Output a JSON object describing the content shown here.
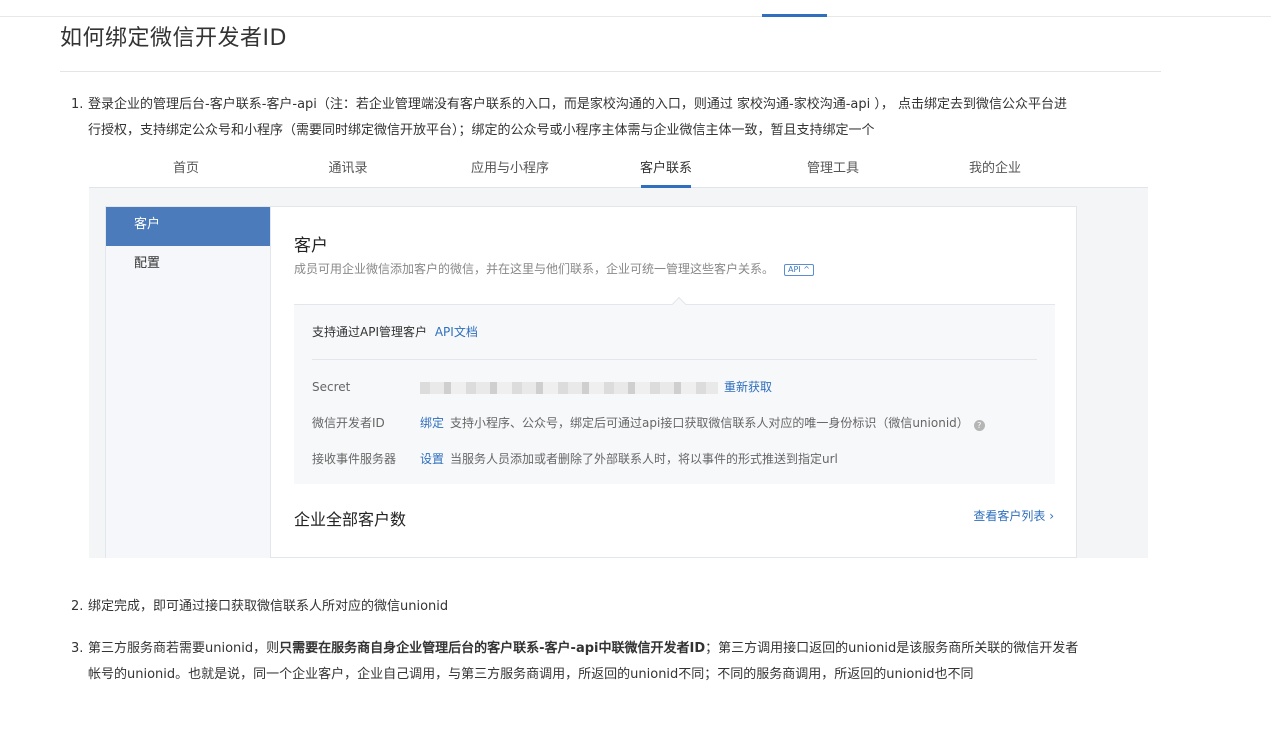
{
  "page": {
    "title": "如何绑定微信开发者ID"
  },
  "steps": [
    {
      "num": "1.",
      "line1": "登录企业的管理后台-客户联系-客户-api（注：若企业管理端没有客户联系的入口，而是家校沟通的入口，则通过 家校沟通-家校沟通-api ）， 点击绑定去到微信公众平台进",
      "line2": "行授权，支持绑定公众号和小程序（需要同时绑定微信开放平台）；绑定的公众号或小程序主体需与企业微信主体一致，暂且支持绑定一个"
    },
    {
      "num": "2.",
      "line1": "绑定完成，即可通过接口获取微信联系人所对应的微信unionid"
    },
    {
      "num": "3.",
      "line1_pre": "第三方服务商若需要unionid，则",
      "line1_bold": "只需要在服务商自身企业管理后台的客户联系-客户-api中联微信开发者ID",
      "line1_post": "；第三方调用接口返回的unionid是该服务商所关联的微信开发者",
      "line2": "帐号的unionid。也就是说，同一个企业客户，企业自己调用，与第三方服务商调用，所返回的unionid不同；不同的服务商调用，所返回的unionid也不同"
    }
  ],
  "screenshot": {
    "nav": [
      "首页",
      "通讯录",
      "应用与小程序",
      "客户联系",
      "管理工具",
      "我的企业"
    ],
    "nav_active_index": 3,
    "sidebar": [
      "客户",
      "配置"
    ],
    "title": "客户",
    "desc": "成员可用企业微信添加客户的微信，并在这里与他们联系，企业可统一管理这些客户关系。",
    "api_badge": "API ^",
    "api_head": "支持通过API管理客户",
    "api_doc_link": "API文档",
    "rows": [
      {
        "label": "Secret",
        "link": "重新获取",
        "text": ""
      },
      {
        "label": "微信开发者ID",
        "link": "绑定",
        "text": "支持小程序、公众号，绑定后可通过api接口获取微信联系人对应的唯一身份标识（微信unionid）",
        "help": "?"
      },
      {
        "label": "接收事件服务器",
        "link": "设置",
        "text": "当服务人员添加或者删除了外部联系人时，将以事件的形式推送到指定url"
      }
    ],
    "section_title": "企业全部客户数",
    "view_list": "查看客户列表 ›"
  }
}
